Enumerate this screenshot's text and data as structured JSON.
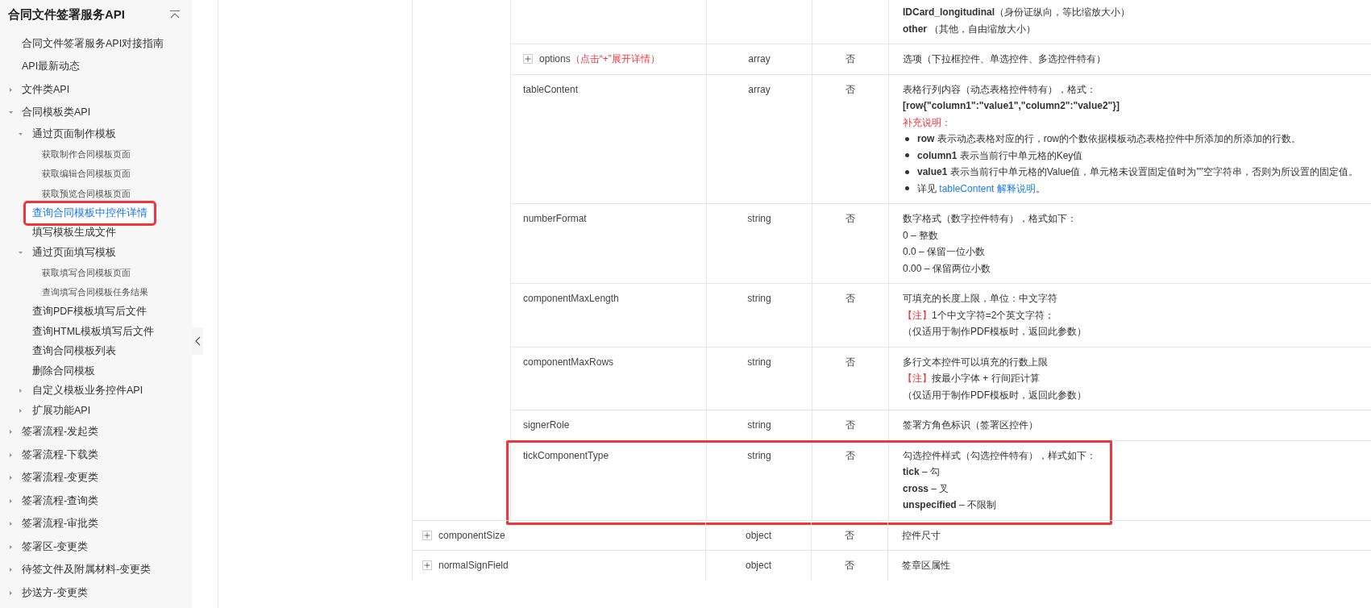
{
  "sidebar": {
    "title": "合同文件签署服务API",
    "items": [
      {
        "label": "合同文件签署服务API对接指南",
        "selected": false,
        "highlighted": false
      },
      {
        "label": "API最新动态",
        "selected": false,
        "highlighted": false
      },
      {
        "label": "文件类API",
        "selected": false,
        "highlighted": false,
        "expanded": false
      },
      {
        "label": "合同模板类API",
        "selected": false,
        "highlighted": false,
        "expanded": true,
        "children": [
          {
            "label": "通过页面制作模板",
            "selected": false,
            "highlighted": false,
            "expanded": true,
            "children": [
              {
                "label": "获取制作合同模板页面",
                "selected": false,
                "highlighted": false
              },
              {
                "label": "获取编辑合同模板页面",
                "selected": false,
                "highlighted": false
              },
              {
                "label": "获取预览合同模板页面",
                "selected": false,
                "highlighted": false
              }
            ]
          },
          {
            "label": "查询合同模板中控件详情",
            "selected": true,
            "highlighted": true
          },
          {
            "label": "填写模板生成文件",
            "selected": false,
            "highlighted": false
          },
          {
            "label": "通过页面填写模板",
            "selected": false,
            "highlighted": false,
            "expanded": true,
            "children": [
              {
                "label": "获取填写合同模板页面",
                "selected": false,
                "highlighted": false
              },
              {
                "label": "查询填写合同模板任务结果",
                "selected": false,
                "highlighted": false
              }
            ]
          },
          {
            "label": "查询PDF模板填写后文件",
            "selected": false,
            "highlighted": false
          },
          {
            "label": "查询HTML模板填写后文件",
            "selected": false,
            "highlighted": false
          },
          {
            "label": "查询合同模板列表",
            "selected": false,
            "highlighted": false
          },
          {
            "label": "删除合同模板",
            "selected": false,
            "highlighted": false
          },
          {
            "label": "自定义模板业务控件API",
            "selected": false,
            "highlighted": false,
            "expanded": false
          },
          {
            "label": "扩展功能API",
            "selected": false,
            "highlighted": false,
            "expanded": false
          }
        ]
      },
      {
        "label": "签署流程-发起类",
        "selected": false,
        "highlighted": false,
        "expanded": false
      },
      {
        "label": "签署流程-下载类",
        "selected": false,
        "highlighted": false,
        "expanded": false
      },
      {
        "label": "签署流程-变更类",
        "selected": false,
        "highlighted": false,
        "expanded": false
      },
      {
        "label": "签署流程-查询类",
        "selected": false,
        "highlighted": false,
        "expanded": false
      },
      {
        "label": "签署流程-审批类",
        "selected": false,
        "highlighted": false,
        "expanded": false
      },
      {
        "label": "签署区-变更类",
        "selected": false,
        "highlighted": false,
        "expanded": false
      },
      {
        "label": "待签文件及附属材料-变更类",
        "selected": false,
        "highlighted": false,
        "expanded": false
      },
      {
        "label": "抄送方-变更类",
        "selected": false,
        "highlighted": false,
        "expanded": false
      }
    ]
  },
  "table": {
    "nested_rows": [
      {
        "highlighted": false,
        "description": [
          {
            "kind": "text",
            "text": "**IDCard_longitudinal**（身份证纵向，等比缩放大小）"
          },
          {
            "kind": "text",
            "text": "**other** （其他，自由缩放大小）"
          }
        ]
      },
      {
        "param": "options",
        "expandable": true,
        "param_note": "（点击“+”展开详情）",
        "type": "array",
        "required": "否",
        "highlighted": false,
        "description": [
          {
            "kind": "text",
            "text": "选项（下拉框控件、单选控件、多选控件特有）"
          }
        ]
      },
      {
        "param": "tableContent",
        "type": "array",
        "required": "否",
        "highlighted": false,
        "description": [
          {
            "kind": "text",
            "text": "表格行列内容（动态表格控件特有），格式："
          },
          {
            "kind": "bold",
            "text": "[row{\"column1\":\"value1\",\"column2\":\"value2\"}]"
          },
          {
            "kind": "red",
            "text": "补充说明："
          },
          {
            "kind": "bullet",
            "text": "**row** 表示动态表格对应的行，row的个数依据模板动态表格控件中所添加的所添加的行数。"
          },
          {
            "kind": "bullet",
            "text": "**column1** 表示当前行中单元格的Key值"
          },
          {
            "kind": "bullet",
            "text": "**value1** 表示当前行中单元格的Value值，单元格未设置固定值时为\"\"空字符串，否则为所设置的固定值。"
          },
          {
            "kind": "bullet",
            "text": "详见 ",
            "link": "tableContent 解释说明",
            "after": "。"
          }
        ]
      },
      {
        "param": "numberFormat",
        "type": "string",
        "required": "否",
        "highlighted": false,
        "description": [
          {
            "kind": "text",
            "text": "数字格式（数字控件特有），格式如下："
          },
          {
            "kind": "text",
            "text": "0 – 整数"
          },
          {
            "kind": "text",
            "text": "0.0 – 保留一位小数"
          },
          {
            "kind": "text",
            "text": "0.00 – 保留两位小数"
          }
        ]
      },
      {
        "param": "componentMaxLength",
        "type": "string",
        "required": "否",
        "highlighted": false,
        "description": [
          {
            "kind": "text",
            "text": "可填充的长度上限，单位：中文字符"
          },
          {
            "kind": "note",
            "note": "【注】",
            "text": "1个中文字符=2个英文字符；"
          },
          {
            "kind": "text",
            "text": "（仅适用于制作PDF模板时，返回此参数）"
          }
        ]
      },
      {
        "param": "componentMaxRows",
        "type": "string",
        "required": "否",
        "highlighted": false,
        "description": [
          {
            "kind": "text",
            "text": "多行文本控件可以填充的行数上限"
          },
          {
            "kind": "note",
            "note": "【注】",
            "text": "按最小字体 + 行间距计算"
          },
          {
            "kind": "text",
            "text": "（仅适用于制作PDF模板时，返回此参数）"
          }
        ]
      },
      {
        "param": "signerRole",
        "type": "string",
        "required": "否",
        "highlighted": false,
        "description": [
          {
            "kind": "text",
            "text": "签署方角色标识（签署区控件）"
          }
        ]
      },
      {
        "param": "tickComponentType",
        "type": "string",
        "required": "否",
        "highlighted": true,
        "description": [
          {
            "kind": "text",
            "text": "勾选控件样式（勾选控件特有），样式如下："
          },
          {
            "kind": "text",
            "text": "**tick** – 勾"
          },
          {
            "kind": "text",
            "text": "**cross** – 叉"
          },
          {
            "kind": "text",
            "text": "**unspecified** – 不限制"
          }
        ]
      }
    ],
    "rows": [
      {
        "param": "componentSize",
        "expandable": true,
        "type": "object",
        "required": "否",
        "highlighted": false,
        "description": [
          {
            "kind": "text",
            "text": "控件尺寸"
          }
        ]
      },
      {
        "param": "normalSignField",
        "expandable": true,
        "type": "object",
        "required": "否",
        "highlighted": false,
        "description": [
          {
            "kind": "text",
            "text": "签章区属性"
          }
        ]
      }
    ]
  }
}
